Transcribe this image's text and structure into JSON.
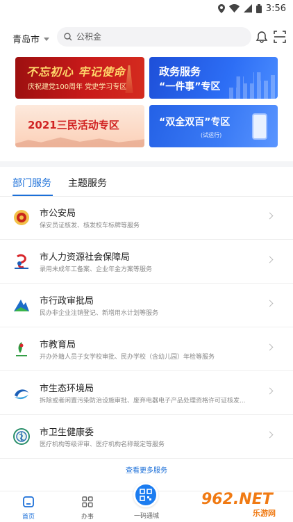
{
  "status_bar": {
    "time": "3:56"
  },
  "header": {
    "city": "青岛市",
    "search_placeholder": "公积金"
  },
  "banners": [
    {
      "title": "不忘初心 牢记使命",
      "subtitle": "庆祝建党100周年  党史学习专区"
    },
    {
      "title": "政务服务",
      "subtitle": "“一件事”专区"
    },
    {
      "title": "2021三民活动专区"
    },
    {
      "title": "“双全双百”专区",
      "subtitle": "(试运行)"
    }
  ],
  "tabs": [
    {
      "label": "部门服务",
      "active": true
    },
    {
      "label": "主题服务",
      "active": false
    }
  ],
  "departments": [
    {
      "name": "市公安局",
      "desc": "保安员证核发、核发校车标牌等服务",
      "icon": "police-emblem-icon"
    },
    {
      "name": "市人力资源社会保障局",
      "desc": "录用未成年工备案、企业年金方案等服务",
      "icon": "hrss-logo-icon"
    },
    {
      "name": "市行政审批局",
      "desc": "民办非企业注销登记、新增用水计划等服务",
      "icon": "approval-logo-icon"
    },
    {
      "name": "市教育局",
      "desc": "开办外籍人员子女学校审批、民办学校（含幼儿园）年检等服务",
      "icon": "education-logo-icon"
    },
    {
      "name": "市生态环境局",
      "desc": "拆除或者闲置污染防治设施审批、废弃电器电子产品处理资格许可证核发...",
      "icon": "ecology-logo-icon"
    },
    {
      "name": "市卫生健康委",
      "desc": "医疗机构等级评审、医疗机构名称裁定等服务",
      "icon": "health-logo-icon"
    }
  ],
  "more_link": "查看更多服务",
  "bottom_nav": {
    "home": "首页",
    "work": "办事",
    "code": "一码通城"
  },
  "watermark": {
    "brand": "962.NET",
    "sub": "乐游网"
  },
  "colors": {
    "accent": "#1b6fd8",
    "watermark": "#f07a13"
  }
}
